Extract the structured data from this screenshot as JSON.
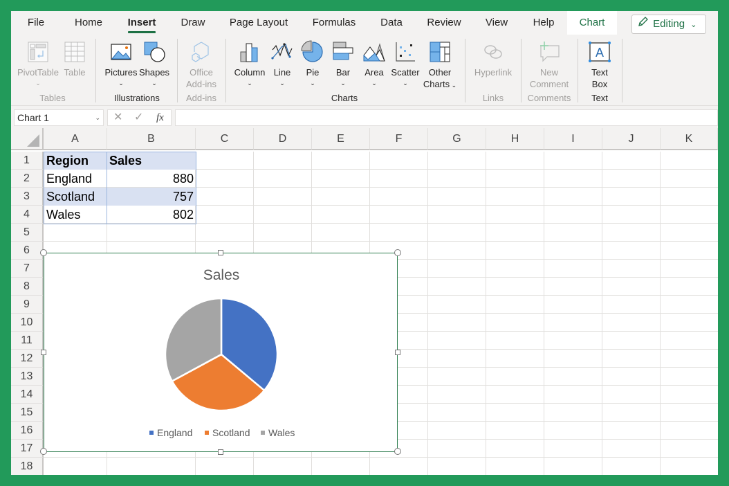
{
  "tabs": [
    {
      "label": "File",
      "active": false
    },
    {
      "label": "Home",
      "active": false
    },
    {
      "label": "Insert",
      "active": true
    },
    {
      "label": "Draw",
      "active": false
    },
    {
      "label": "Page Layout",
      "active": false
    },
    {
      "label": "Formulas",
      "active": false
    },
    {
      "label": "Data",
      "active": false
    },
    {
      "label": "Review",
      "active": false
    },
    {
      "label": "View",
      "active": false
    },
    {
      "label": "Help",
      "active": false
    },
    {
      "label": "Chart",
      "active": false,
      "contextual": true
    }
  ],
  "editing_button": {
    "label": "Editing",
    "icon": "pencil-icon"
  },
  "ribbon": {
    "groups": {
      "tables": "Tables",
      "illustrations": "Illustrations",
      "addins": "Add-ins",
      "charts": "Charts",
      "links": "Links",
      "comments": "Comments",
      "text": "Text"
    },
    "buttons": {
      "pivottable": "PivotTable",
      "table": "Table",
      "pictures": "Pictures",
      "shapes": "Shapes",
      "office_addins_1": "Office",
      "office_addins_2": "Add-ins",
      "column": "Column",
      "line": "Line",
      "pie": "Pie",
      "bar": "Bar",
      "area": "Area",
      "scatter": "Scatter",
      "other_charts_1": "Other",
      "other_charts_2": "Charts",
      "hyperlink": "Hyperlink",
      "new_comment_1": "New",
      "new_comment_2": "Comment",
      "text_box_1": "Text",
      "text_box_2": "Box"
    },
    "chevron": "⌄"
  },
  "formula_bar": {
    "name_box": "Chart 1",
    "cancel": "✕",
    "enter": "✓",
    "fx": "fx",
    "formula": ""
  },
  "columns": [
    "A",
    "B",
    "C",
    "D",
    "E",
    "F",
    "G",
    "H",
    "I",
    "J",
    "K"
  ],
  "rows": [
    "1",
    "2",
    "3",
    "4",
    "5",
    "6",
    "7",
    "8",
    "9",
    "10",
    "11",
    "12",
    "13",
    "14",
    "15",
    "16",
    "17",
    "18"
  ],
  "sheet": {
    "header": [
      "Region",
      "Sales"
    ],
    "data": [
      [
        "England",
        "880"
      ],
      [
        "Scotland",
        "757"
      ],
      [
        "Wales",
        "802"
      ]
    ]
  },
  "chart_data": {
    "type": "pie",
    "title": "Sales",
    "categories": [
      "England",
      "Scotland",
      "Wales"
    ],
    "values": [
      880,
      757,
      802
    ],
    "colors": [
      "#4472C4",
      "#ED7D31",
      "#A5A5A5"
    ],
    "legend": "bottom",
    "start_angle_deg": 0
  },
  "colors": {
    "frame": "#229A5A",
    "accent": "#1E7145",
    "table_highlight": "#D9E1F2"
  }
}
